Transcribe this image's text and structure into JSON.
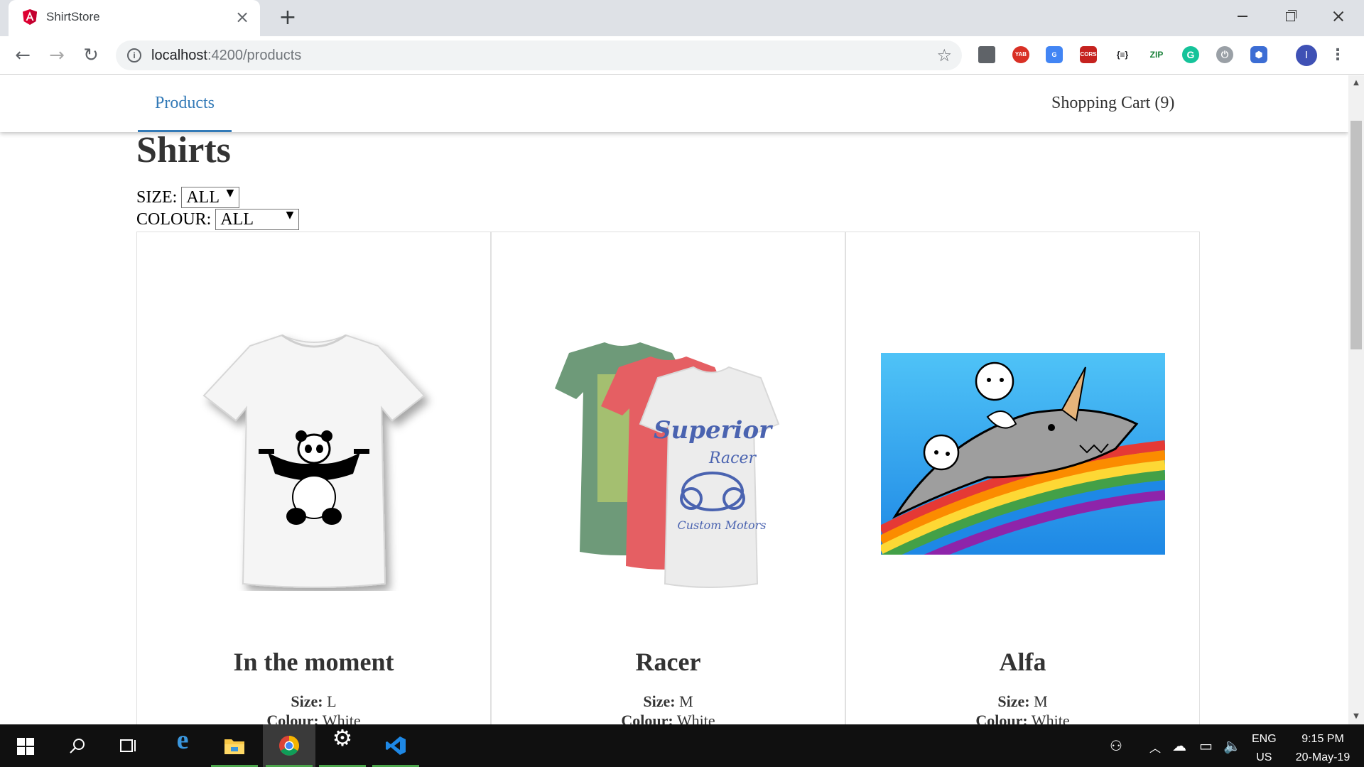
{
  "browser": {
    "tab_title": "ShirtStore",
    "url_host": "localhost",
    "url_rest": ":4200/products",
    "extensions": [
      "YAB",
      "CORS",
      "{≡}",
      "ZIP"
    ],
    "profile_initial": "I"
  },
  "app": {
    "nav": {
      "products_label": "Products",
      "cart_label": "Shopping Cart (9)"
    },
    "page_title": "Shirts",
    "filters": {
      "size_label": "SIZE:",
      "size_value": "ALL",
      "colour_label": "COLOUR:",
      "colour_value": "ALL"
    },
    "size_key": "Size:",
    "colour_key": "Colour:",
    "products": [
      {
        "name": "In the moment",
        "size": "L",
        "colour": "White"
      },
      {
        "name": "Racer",
        "size": "M",
        "colour": "White"
      },
      {
        "name": "Alfa",
        "size": "M",
        "colour": "White"
      }
    ]
  },
  "taskbar": {
    "language": "ENG",
    "region": "US",
    "time": "9:15 PM",
    "date": "20-May-19"
  },
  "colors": {
    "accent": "#337ab7",
    "angular_red": "#dd0031",
    "taskbar": "#101010"
  }
}
